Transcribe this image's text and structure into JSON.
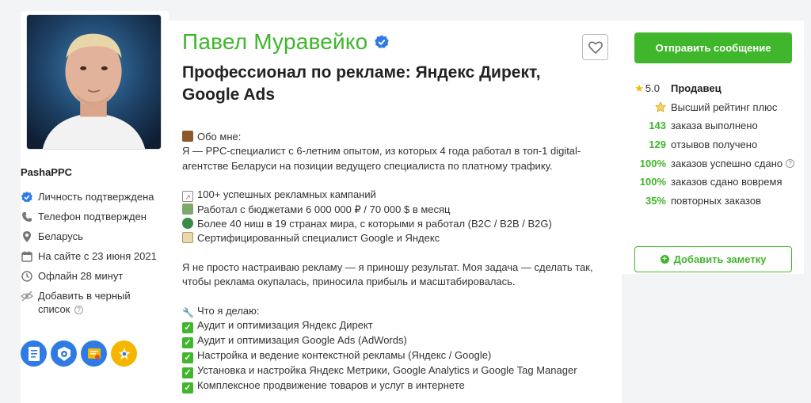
{
  "profile": {
    "username": "PashaPPC",
    "name": "Павел Муравейко",
    "headline": "Профессионал по рекламе: Яндекс Директ, Google Ads"
  },
  "left_info": [
    {
      "icon": "verified-check-icon",
      "text": "Личность подтверждена"
    },
    {
      "icon": "phone-icon",
      "text": "Телефон подтвержден"
    },
    {
      "icon": "location-pin-icon",
      "text": "Беларусь"
    },
    {
      "icon": "calendar-icon",
      "text": "На сайте с 23 июня 2021"
    },
    {
      "icon": "clock-icon",
      "text": "Офлайн 28 минут"
    },
    {
      "icon": "hidden-eye-icon",
      "text_line1": "Добавить в черный",
      "text_line2": "список",
      "help": "?"
    }
  ],
  "about": {
    "header": "Обо мне:",
    "intro": "Я — PPC-специалист с 6-летним опытом, из которых 4 года работал в топ-1 digital-агентстве Беларуси на позиции ведущего специалиста по платному трафику.",
    "achievements": [
      "100+ успешных рекламных кампаний",
      "Работал с бюджетами 6 000 000 ₽ / 70 000 $ в месяц",
      "Более 40 ниш в 19 странах мира, с которыми я работал (B2C / B2B / B2G)",
      "Сертифицированный специалист Google и Яндекс"
    ],
    "statement": "Я не просто настраиваю рекламу — я приношу результат. Моя задача — сделать так, чтобы реклама окупалась, приносила прибыль и масштабировалась.",
    "services_header": "Что я делаю:",
    "services": [
      "Аудит и оптимизация Яндекс Директ",
      "Аудит и оптимизация Google Ads (AdWords)",
      "Настройка и ведение контекстной рекламы (Яндекс / Google)",
      "Установка и настройка Яндекс Метрики, Google Analytics и Google Tag Manager",
      "Комплексное продвижение товаров и услуг в интернете"
    ]
  },
  "sidebar": {
    "send_message": "Отправить сообщение",
    "rating_value": "5.0",
    "rating_label": "Продавец",
    "top_rating": "Высший рейтинг плюс",
    "stats": [
      {
        "num": "143",
        "label": "заказа выполнено"
      },
      {
        "num": "129",
        "label": "отзывов получено"
      },
      {
        "num": "100%",
        "label": "заказов успешно сдано",
        "help": "?"
      },
      {
        "num": "100%",
        "label": "заказов сдано вовремя"
      },
      {
        "num": "35%",
        "label": "повторных заказов"
      }
    ],
    "add_note": "Добавить заметку"
  },
  "colors": {
    "accent": "#3fb62b",
    "star": "#f6b600",
    "verified": "#2f7be5"
  }
}
